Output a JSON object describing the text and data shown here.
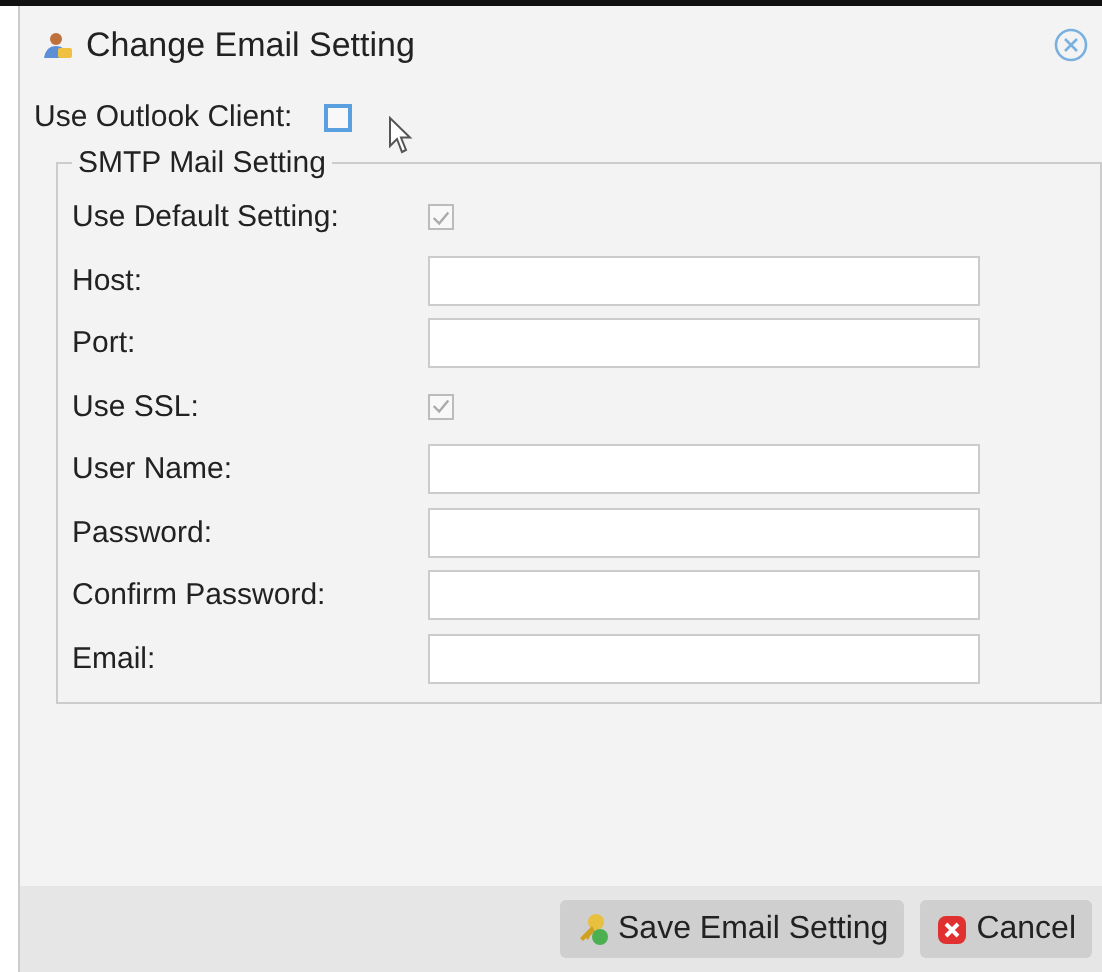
{
  "window": {
    "title": "Change Email Setting"
  },
  "outlook": {
    "label": "Use Outlook Client:",
    "checked": false
  },
  "smtp": {
    "legend": "SMTP Mail Setting",
    "rows": [
      {
        "kind": "checkbox",
        "label": "Use Default Setting:",
        "checked": true,
        "disabled": true
      },
      {
        "kind": "field",
        "label": "Host:"
      },
      {
        "kind": "field",
        "label": "Port:"
      },
      {
        "kind": "checkbox",
        "label": "Use SSL:",
        "checked": true,
        "disabled": true
      },
      {
        "kind": "field",
        "label": "User Name:"
      },
      {
        "kind": "field",
        "label": "Password:"
      },
      {
        "kind": "field",
        "label": "Confirm Password:"
      },
      {
        "kind": "field",
        "label": "Email:"
      }
    ]
  },
  "buttons": [
    {
      "kind": "save",
      "label": "Save Email Setting"
    },
    {
      "kind": "cancel",
      "label": "Cancel"
    }
  ]
}
